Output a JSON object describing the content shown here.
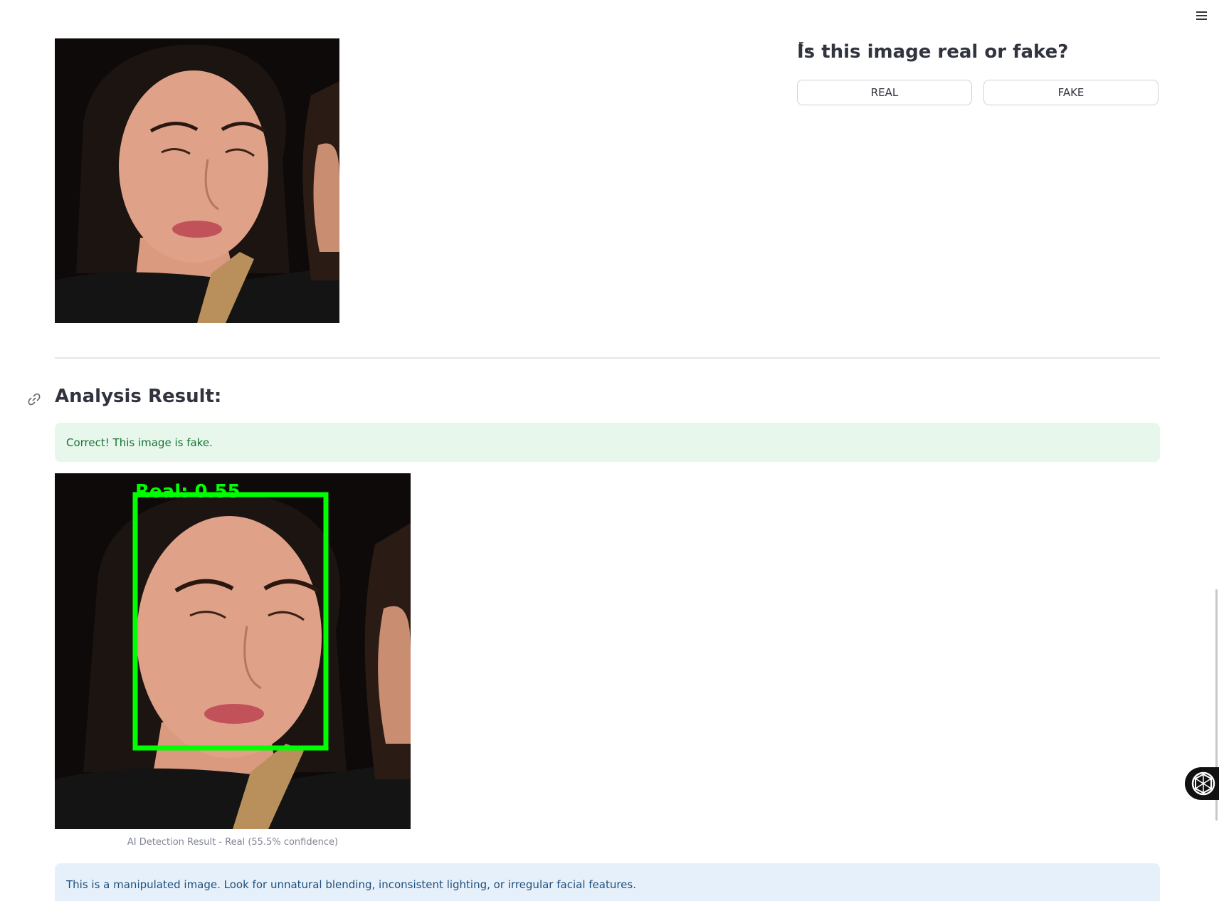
{
  "menu": {
    "icon": "hamburger-menu-icon"
  },
  "quiz": {
    "question": "Is this image real or fake?",
    "real_label": "REAL",
    "fake_label": "FAKE"
  },
  "analysis": {
    "heading": "Analysis Result:",
    "success_message": "Correct! This image is fake.",
    "box_label": "Real: 0.55",
    "caption": "AI Detection Result - Real (55.5% confidence)",
    "info_message": "This is a manipulated image. Look for unnatural blending, inconsistent lighting, or irregular facial features."
  },
  "colors": {
    "accent_text": "#31333f",
    "success_bg": "#e8f7ec",
    "success_text": "#177233",
    "info_bg": "#e6f0fb",
    "info_text": "#1f4e7a",
    "box_green": "#00ff00"
  }
}
